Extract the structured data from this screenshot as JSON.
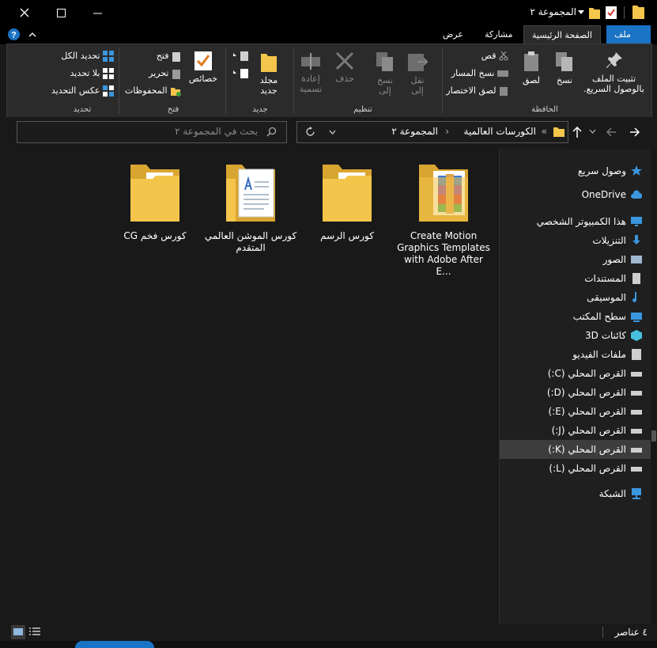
{
  "window": {
    "title": "المجموعة ٢",
    "close_icon": "close-icon",
    "maximize_icon": "maximize-icon",
    "minimize_icon": "minimize-icon"
  },
  "tabs": {
    "file": "ملف",
    "home": "الصفحة الرئيسية",
    "share": "مشاركة",
    "view": "عرض"
  },
  "ribbon": {
    "pin": "تثبيت الملف بالوصول السريع.",
    "copy": "نسخ",
    "paste": "لصق",
    "cut": "قص",
    "copy_path": "نسخ المسار",
    "paste_shortcut": "لصق الاختصار",
    "clipboard": "الحافظة",
    "move_to": "نقل إلى",
    "copy_to": "نسخ إلى",
    "delete": "حذف",
    "rename": "إعادة تسمية",
    "organize": "تنظيم",
    "new_folder": "مجلد جديد",
    "new": "جديد",
    "properties": "خصائص",
    "open": "فتح",
    "edit": "تحرير",
    "history": "المحفوظات",
    "open_group": "فتح",
    "select_all": "تحديد الكل",
    "select_none": "بلا تحديد",
    "invert_selection": "عكس التحديد",
    "select_group": "تحديد"
  },
  "nav": {
    "breadcrumb_1": "الكورسات العالمية",
    "breadcrumb_2": "المجموعة ٢",
    "search_placeholder": "بحث في المجموعة ٢"
  },
  "files": [
    {
      "name": "Create Motion Graphics Templates with Adobe After E...",
      "icon": "archive-folder-icon"
    },
    {
      "name": "كورس الرسم",
      "icon": "folder-icon"
    },
    {
      "name": "كورس الموشن العالمي المتقدم",
      "icon": "folder-document-icon"
    },
    {
      "name": "كورس فخم CG",
      "icon": "folder-icon"
    }
  ],
  "sidebar": [
    {
      "label": "وصول سريع",
      "icon": "star-icon",
      "color": "#3a96dd"
    },
    {
      "label": "OneDrive",
      "icon": "cloud-icon",
      "color": "#3a96dd"
    },
    {
      "label": "هذا الكمبيوتر الشخصي",
      "icon": "computer-icon",
      "color": "#3a96dd"
    },
    {
      "label": "التنزيلات",
      "icon": "download-icon",
      "color": "#3a96dd"
    },
    {
      "label": "الصور",
      "icon": "pictures-icon",
      "color": "#9fb8d0"
    },
    {
      "label": "المستندات",
      "icon": "documents-icon",
      "color": "#cfcfcf"
    },
    {
      "label": "الموسيقى",
      "icon": "music-icon",
      "color": "#3a96dd"
    },
    {
      "label": "سطح المكتب",
      "icon": "desktop-icon",
      "color": "#3a96dd"
    },
    {
      "label": "كائنات 3D",
      "icon": "cube-icon",
      "color": "#48c1e0"
    },
    {
      "label": "ملفات الفيديو",
      "icon": "video-icon",
      "color": "#cfcfcf"
    },
    {
      "label": "القرص المحلي (C:)",
      "icon": "drive-icon",
      "color": "#cfcfcf"
    },
    {
      "label": "القرص المحلي (D:)",
      "icon": "drive-icon",
      "color": "#cfcfcf"
    },
    {
      "label": "القرص المحلي (E:)",
      "icon": "drive-icon",
      "color": "#cfcfcf"
    },
    {
      "label": "القرص المحلي (J:)",
      "icon": "drive-icon",
      "color": "#cfcfcf"
    },
    {
      "label": "القرص المحلي (K:)",
      "icon": "drive-icon",
      "color": "#cfcfcf",
      "selected": true
    },
    {
      "label": "القرص المحلي (L:)",
      "icon": "drive-icon",
      "color": "#cfcfcf"
    },
    {
      "label": "الشبكة",
      "icon": "network-icon",
      "color": "#3a96dd"
    }
  ],
  "status": {
    "count": "٤ عناصر"
  },
  "colors": {
    "accent": "#1a73c4",
    "folder": "#f3c54b",
    "background": "#191919"
  }
}
